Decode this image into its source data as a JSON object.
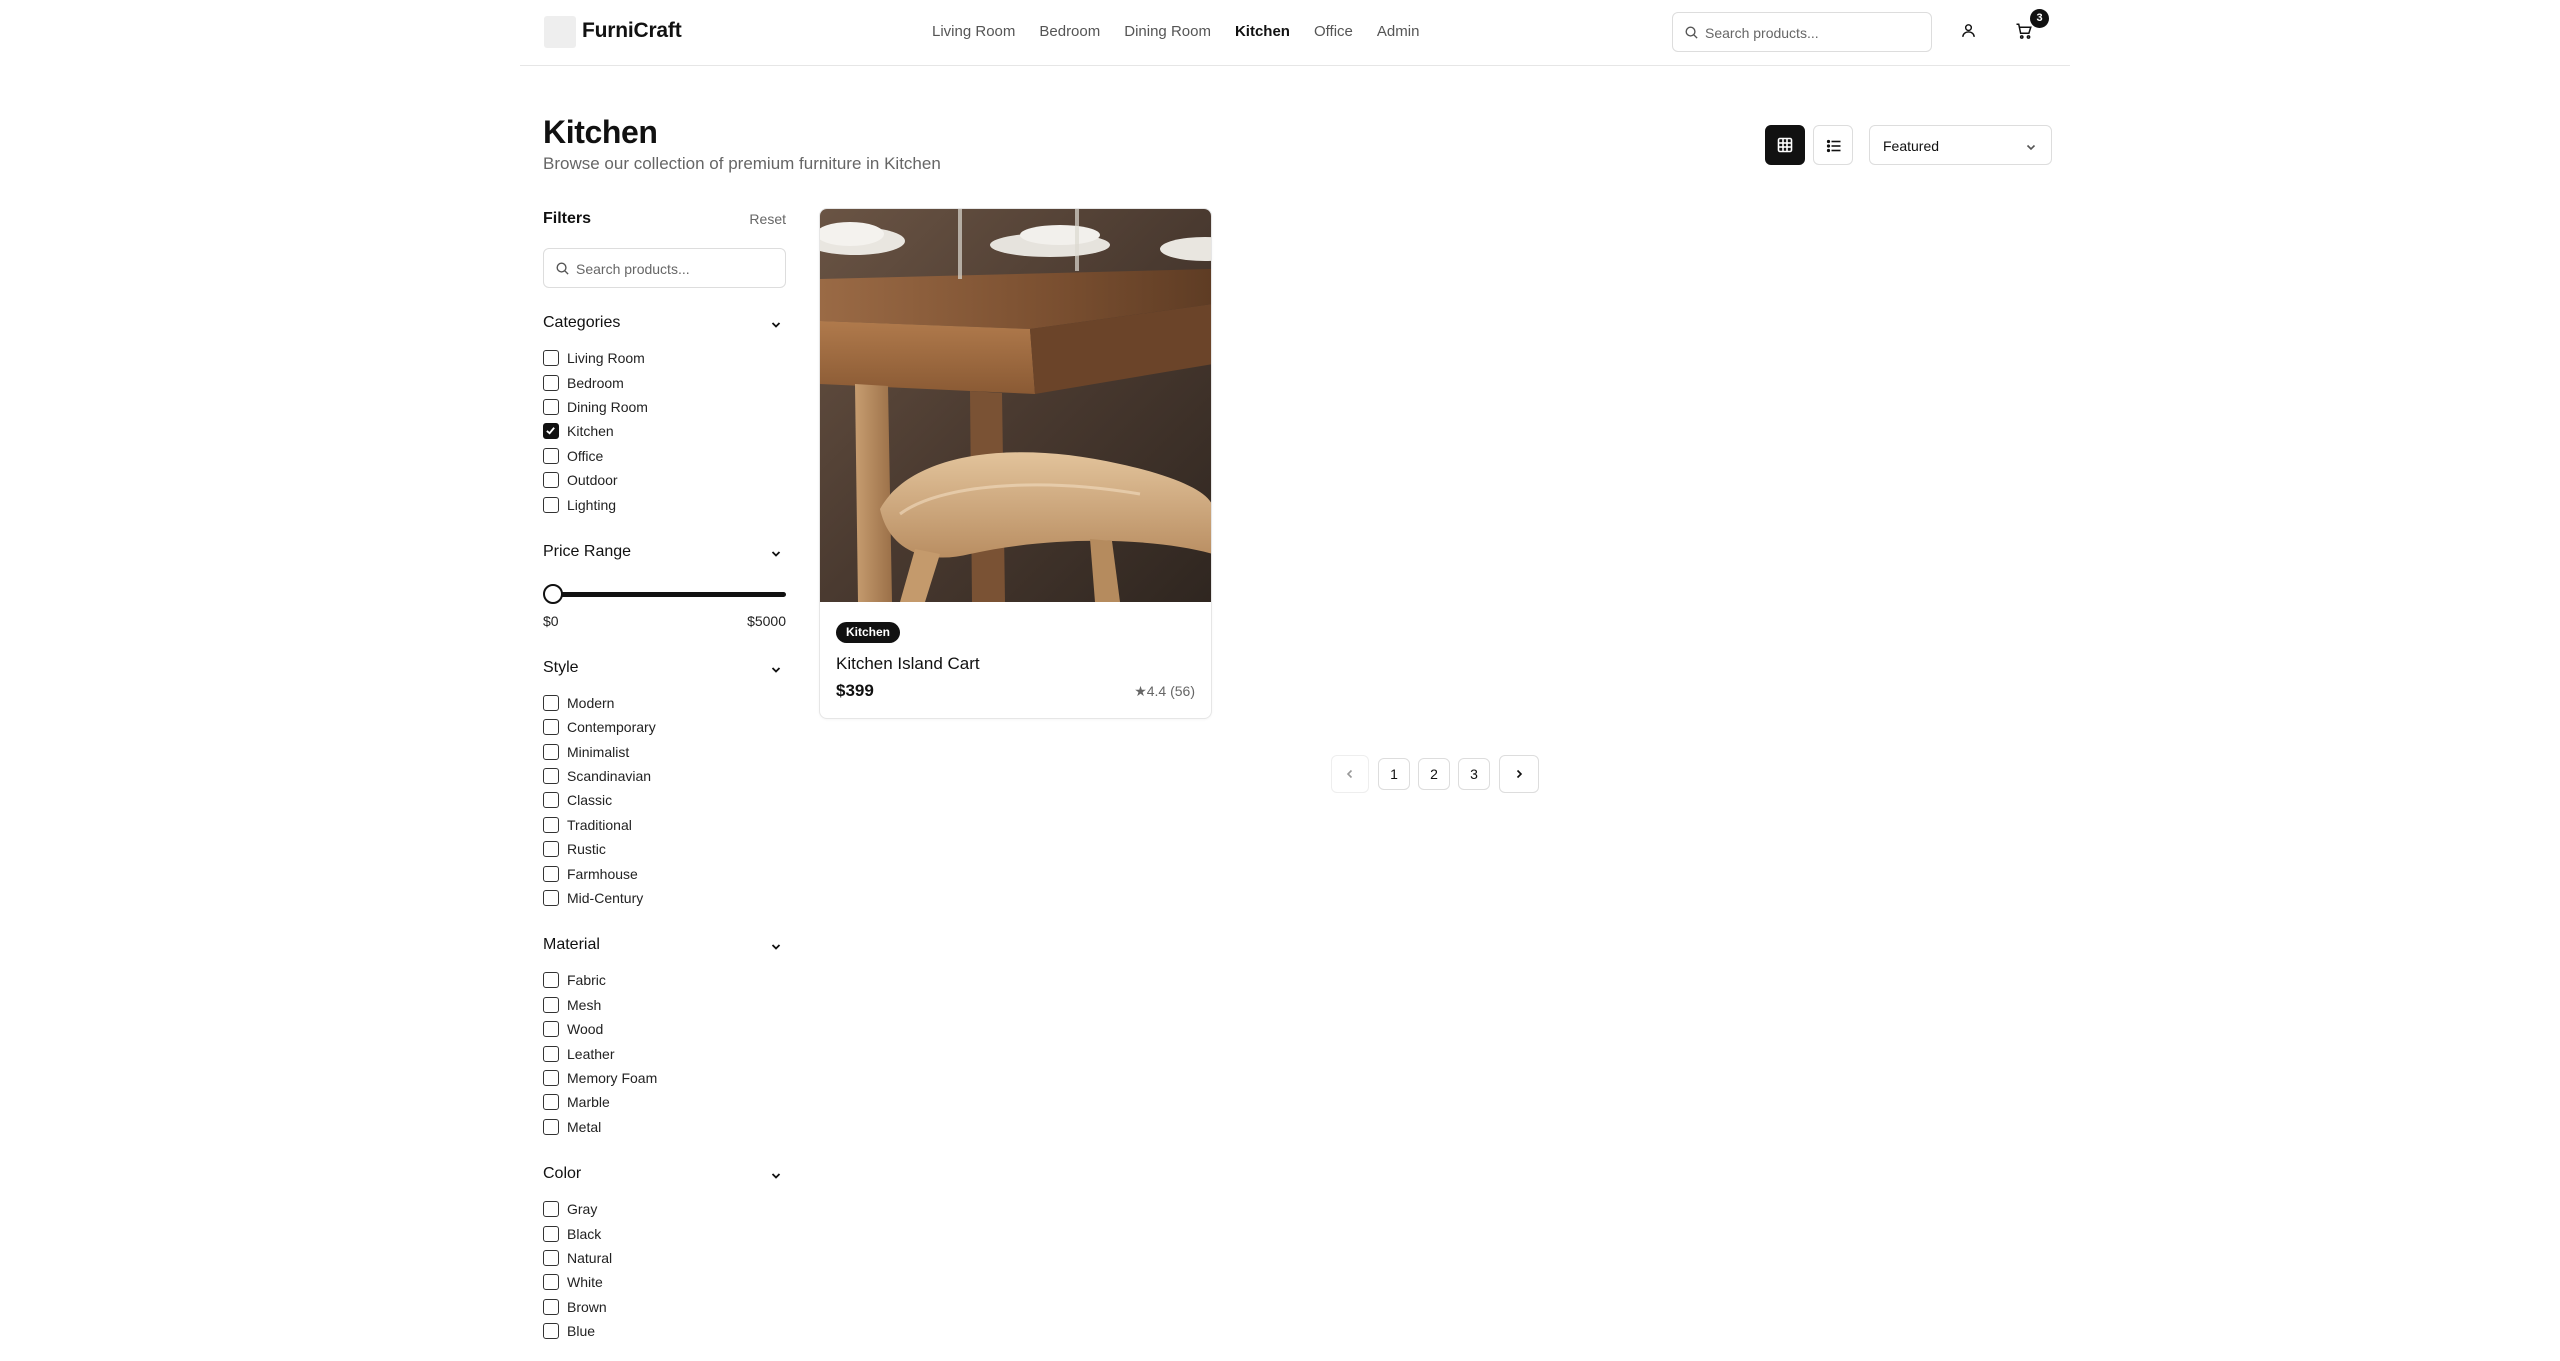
{
  "header": {
    "logo_text": "FurniCraft",
    "nav": [
      {
        "label": "Living Room",
        "active": false
      },
      {
        "label": "Bedroom",
        "active": false
      },
      {
        "label": "Dining Room",
        "active": false
      },
      {
        "label": "Kitchen",
        "active": true
      },
      {
        "label": "Office",
        "active": false
      },
      {
        "label": "Admin",
        "active": false
      }
    ],
    "search_placeholder": "Search products...",
    "cart_count": "3"
  },
  "page": {
    "title": "Kitchen",
    "subtitle": "Browse our collection of premium furniture in Kitchen",
    "view_mode": "grid",
    "sort_selected": "Featured"
  },
  "sidebar": {
    "filters_title": "Filters",
    "reset_label": "Reset",
    "search_placeholder": "Search products...",
    "categories": {
      "title": "Categories",
      "items": [
        {
          "label": "Living Room",
          "checked": false
        },
        {
          "label": "Bedroom",
          "checked": false
        },
        {
          "label": "Dining Room",
          "checked": false
        },
        {
          "label": "Kitchen",
          "checked": true
        },
        {
          "label": "Office",
          "checked": false
        },
        {
          "label": "Outdoor",
          "checked": false
        },
        {
          "label": "Lighting",
          "checked": false
        }
      ]
    },
    "price": {
      "title": "Price Range",
      "min_label": "$0",
      "max_label": "$5000",
      "slider_value_fraction": 0
    },
    "style": {
      "title": "Style",
      "items": [
        {
          "label": "Modern",
          "checked": false
        },
        {
          "label": "Contemporary",
          "checked": false
        },
        {
          "label": "Minimalist",
          "checked": false
        },
        {
          "label": "Scandinavian",
          "checked": false
        },
        {
          "label": "Classic",
          "checked": false
        },
        {
          "label": "Traditional",
          "checked": false
        },
        {
          "label": "Rustic",
          "checked": false
        },
        {
          "label": "Farmhouse",
          "checked": false
        },
        {
          "label": "Mid-Century",
          "checked": false
        }
      ]
    },
    "material": {
      "title": "Material",
      "items": [
        {
          "label": "Fabric",
          "checked": false
        },
        {
          "label": "Mesh",
          "checked": false
        },
        {
          "label": "Wood",
          "checked": false
        },
        {
          "label": "Leather",
          "checked": false
        },
        {
          "label": "Memory Foam",
          "checked": false
        },
        {
          "label": "Marble",
          "checked": false
        },
        {
          "label": "Metal",
          "checked": false
        }
      ]
    },
    "color": {
      "title": "Color",
      "items": [
        {
          "label": "Gray",
          "checked": false
        },
        {
          "label": "Black",
          "checked": false
        },
        {
          "label": "Natural",
          "checked": false
        },
        {
          "label": "White",
          "checked": false
        },
        {
          "label": "Brown",
          "checked": false
        },
        {
          "label": "Blue",
          "checked": false
        }
      ]
    }
  },
  "products": [
    {
      "category_badge": "Kitchen",
      "name": "Kitchen Island Cart",
      "price": "$399",
      "rating": "★4.4 (56)"
    }
  ],
  "pagination": {
    "pages": [
      "1",
      "2",
      "3"
    ]
  },
  "colors": {
    "primary": "#111111",
    "muted_text": "#666666",
    "border": "#dddddd"
  }
}
